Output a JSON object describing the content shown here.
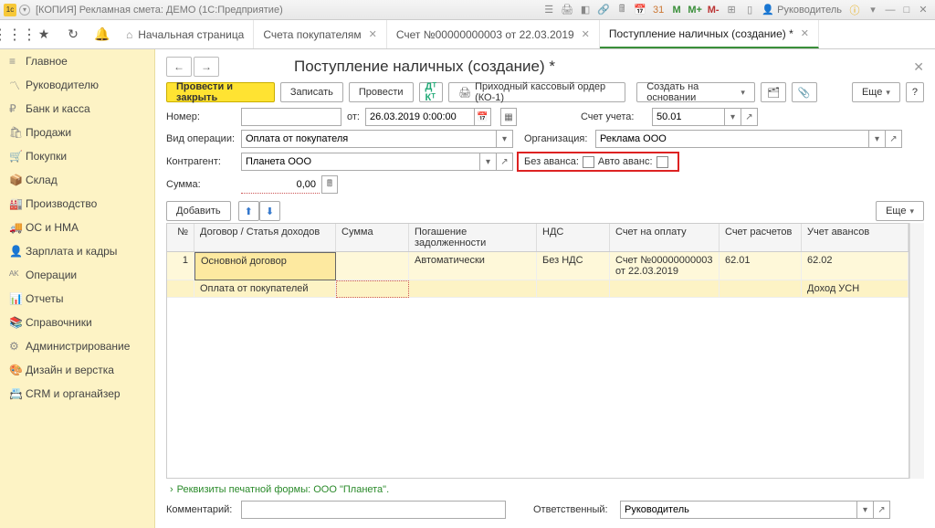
{
  "title_bar": {
    "title": "[КОПИЯ] Рекламная смета: ДЕМО  (1С:Предприятие)",
    "user": "Руководитель"
  },
  "tabs": {
    "home": "Начальная страница",
    "t1": "Счета покупателям",
    "t2": "Счет №00000000003 от 22.03.2019",
    "t3": "Поступление наличных (создание) *"
  },
  "sidebar": [
    {
      "ico": "≡",
      "lbl": "Главное"
    },
    {
      "ico": "〽",
      "lbl": "Руководителю"
    },
    {
      "ico": "₽",
      "lbl": "Банк и касса"
    },
    {
      "ico": "🛍",
      "lbl": "Продажи"
    },
    {
      "ico": "🛒",
      "lbl": "Покупки"
    },
    {
      "ico": "📦",
      "lbl": "Склад"
    },
    {
      "ico": "🏭",
      "lbl": "Производство"
    },
    {
      "ico": "🚚",
      "lbl": "ОС и НМА"
    },
    {
      "ico": "👤",
      "lbl": "Зарплата и кадры"
    },
    {
      "ico": "ᴬᴷ",
      "lbl": "Операции"
    },
    {
      "ico": "📊",
      "lbl": "Отчеты"
    },
    {
      "ico": "📚",
      "lbl": "Справочники"
    },
    {
      "ico": "⚙",
      "lbl": "Администрирование"
    },
    {
      "ico": "🎨",
      "lbl": "Дизайн и верстка"
    },
    {
      "ico": "📇",
      "lbl": "CRM и органайзер"
    }
  ],
  "page": {
    "title": "Поступление наличных (создание) *",
    "toolbar": {
      "post_close": "Провести и закрыть",
      "write": "Записать",
      "post": "Провести",
      "print": "Приходный кассовый ордер (КО-1)",
      "create_based": "Создать на основании",
      "more": "Еще"
    },
    "form": {
      "number_lbl": "Номер:",
      "number": "",
      "from_lbl": "от:",
      "date": "26.03.2019 0:00:00",
      "account_lbl": "Счет учета:",
      "account": "50.01",
      "op_lbl": "Вид операции:",
      "op": "Оплата от покупателя",
      "org_lbl": "Организация:",
      "org": "Реклама ООО",
      "contr_lbl": "Контрагент:",
      "contr": "Планета ООО",
      "no_advance": "Без аванса:",
      "auto_advance": "Авто аванс:",
      "sum_lbl": "Сумма:",
      "sum": "0,00",
      "add": "Добавить"
    },
    "grid": {
      "headers": {
        "n": "№",
        "dog": "Договор / Статья доходов",
        "sum": "Сумма",
        "pog": "Погашение задолженности",
        "nds": "НДС",
        "schet": "Счет на оплату",
        "rasch": "Счет расчетов",
        "avans": "Учет авансов"
      },
      "row1": {
        "n": "1",
        "dog": "Основной договор",
        "sum": "",
        "pog": "Автоматически",
        "nds": "Без НДС",
        "schet": "Счет №00000000003 от 22.03.2019",
        "rasch": "62.01",
        "avans": "62.02"
      },
      "row2": {
        "dog": "Оплата от покупателей",
        "avans": "Доход УСН"
      }
    },
    "print_req": "Реквизиты печатной формы: ООО \"Планета\".",
    "comment_lbl": "Комментарий:",
    "resp_lbl": "Ответственный:",
    "resp": "Руководитель"
  }
}
